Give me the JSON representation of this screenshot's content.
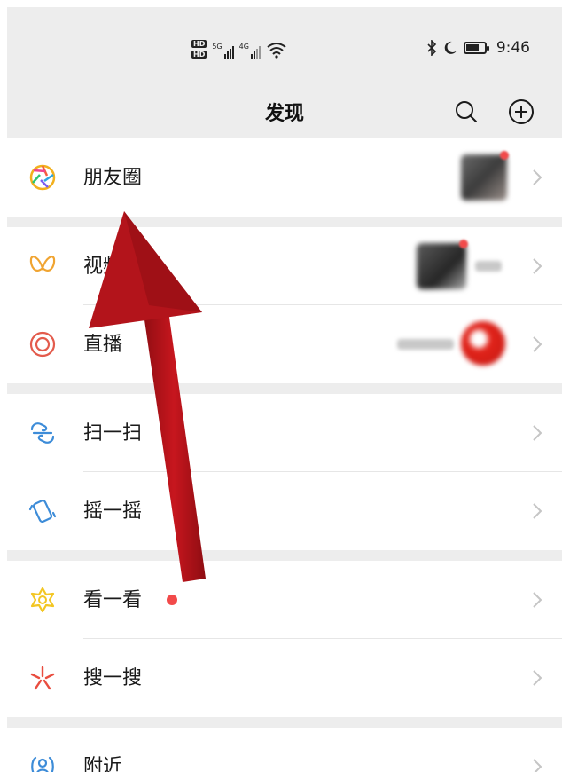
{
  "status_bar": {
    "network_left": "5G",
    "network_right": "4G",
    "hd_badge": "HD",
    "time": "9:46"
  },
  "header": {
    "title": "发现",
    "search_icon": "search-icon",
    "add_icon": "plus-circle-icon"
  },
  "items": [
    {
      "label": "朋友圈",
      "icon": "moments-aperture-icon"
    },
    {
      "label": "视频号",
      "icon": "channels-butterfly-icon"
    },
    {
      "label": "直播",
      "icon": "live-ring-icon"
    },
    {
      "label": "扫一扫",
      "icon": "scan-icon"
    },
    {
      "label": "摇一摇",
      "icon": "shake-icon"
    },
    {
      "label": "看一看",
      "icon": "top-stories-icon"
    },
    {
      "label": "搜一搜",
      "icon": "search-sparkle-icon"
    },
    {
      "label": "附近",
      "icon": "nearby-person-icon"
    }
  ],
  "annotation": {
    "arrow_color": "#b3141b"
  },
  "colors": {
    "background": "#ededed",
    "card": "#ffffff",
    "badge_red": "#f24a4a"
  }
}
